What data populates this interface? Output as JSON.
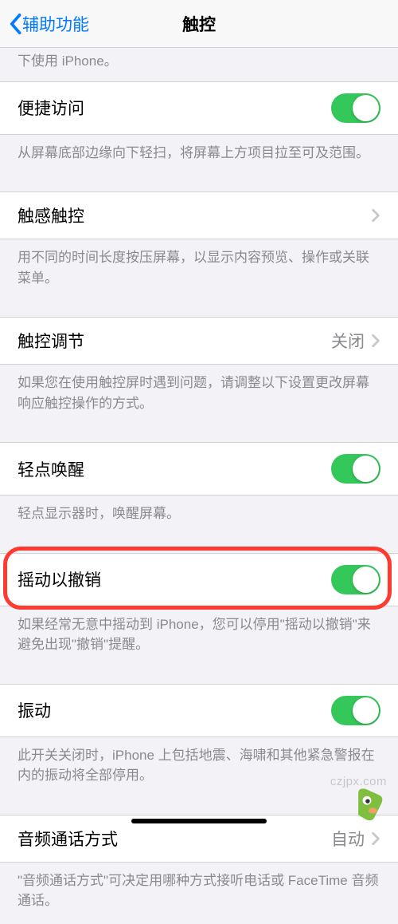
{
  "nav": {
    "back": "辅助功能",
    "title": "触控"
  },
  "topCut": "下使用 iPhone。",
  "rows": {
    "reachability": {
      "label": "便捷访问",
      "footer": "从屏幕底部边缘向下轻扫，将屏幕上方项目拉至可及范围。"
    },
    "haptic": {
      "label": "触感触控",
      "footer": "用不同的时间长度按压屏幕，以显示内容预览、操作或关联菜单。"
    },
    "accom": {
      "label": "触控调节",
      "value": "关闭",
      "footer": "如果您在使用触控屏时遇到问题，请调整以下设置更改屏幕响应触控操作的方式。"
    },
    "tapwake": {
      "label": "轻点唤醒",
      "footer": "轻点显示器时，唤醒屏幕。"
    },
    "shake": {
      "label": "摇动以撤销",
      "footer": "如果经常无意中摇动到 iPhone，您可以停用\"摇动以撤销\"来避免出现\"撤销\"提醒。"
    },
    "vibration": {
      "label": "振动",
      "footer": "此开关关闭时，iPhone 上包括地震、海啸和其他紧急警报在内的振动将全部停用。"
    },
    "audiocall": {
      "label": "音频通话方式",
      "value": "自动",
      "footer": "\"音频通话方式\"可决定用哪种方式接听电话或 FaceTime 音频通话。"
    }
  },
  "watermark": "czjpx.com"
}
